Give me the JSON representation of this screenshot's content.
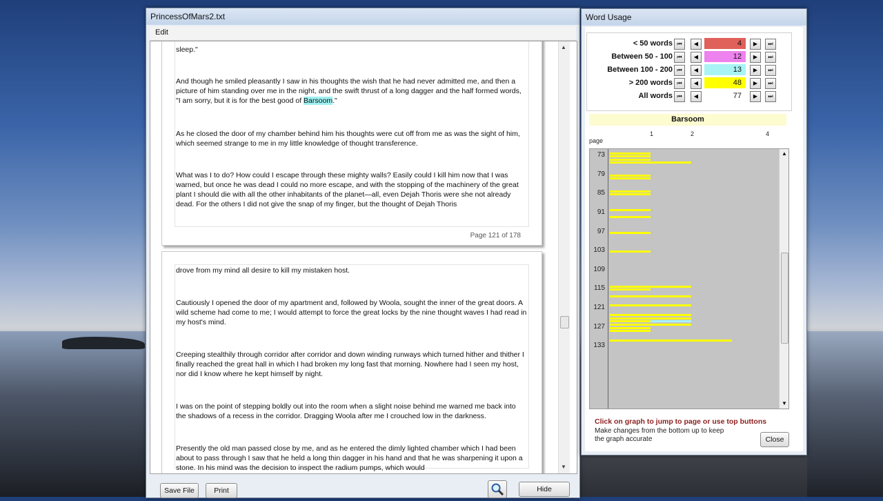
{
  "main_window": {
    "title": "PrincessOfMars2.txt",
    "menu": [
      "Edit"
    ],
    "page1": {
      "paragraphs": [
        "sleep.\"",
        "And though he smiled pleasantly I saw in his thoughts the wish that he had never admitted me, and then a picture of him standing over me in the night, and the swift thrust of a long dagger and the half formed words, \"I am sorry, but it is for the best good of ",
        "As he closed the door of my chamber behind him his thoughts were cut off from me as was the sight of him, which seemed strange to me in my little knowledge of thought transference.",
        "What was I to do? How could I escape through these mighty walls? Easily could I kill him now that I was warned, but once he was dead I could no more escape, and with the stopping of the machinery of the great plant I should die with all the other inhabitants of the planet—all, even Dejah Thoris were she not already dead. For the others I did not give the snap of my finger, but the thought of Dejah Thoris"
      ],
      "highlight_word": "Barsoom",
      "after_highlight": ".\"",
      "page_label": "Page 121 of 178"
    },
    "page2": {
      "paragraphs": [
        "drove from my mind all desire to kill my mistaken host.",
        "Cautiously I opened the door of my apartment and, followed by Woola, sought the inner of the great doors. A wild scheme had come to me; I would attempt to force the great locks by the nine thought waves I had read in my host's mind.",
        "Creeping stealthily through corridor after corridor and down winding runways which turned hither and thither I finally reached the great hall in which I had broken my long fast that morning. Nowhere had I seen my host, nor did I know where he kept himself by night.",
        "I was on the point of stepping boldly out into the room when a slight noise behind me warned me back into the shadows of a recess in the corridor. Dragging Woola after me I crouched low in the darkness.",
        "Presently the old man passed close by me, and as he entered the dimly lighted chamber which I had been about to pass through I saw that he held a long thin dagger in his hand and that he was sharpening it upon a stone. In his mind was the decision to inspect the radium pumps, which would"
      ]
    },
    "buttons": {
      "save": "Save File",
      "print": "Print",
      "hide": "Hide",
      "search_icon": "magnifier-icon"
    }
  },
  "word_usage": {
    "title": "Word Usage",
    "rows": [
      {
        "label": "< 50 words",
        "count": "4",
        "color": "#e0605a"
      },
      {
        "label": "Between 50 - 100",
        "count": "12",
        "color": "#ee82ee"
      },
      {
        "label": "Between 100 - 200",
        "count": "13",
        "color": "#a8f4f4"
      },
      {
        "label": "> 200 words",
        "count": "48",
        "color": "#ffff00"
      },
      {
        "label": "All words",
        "count": "77",
        "color": "#ffffff"
      }
    ],
    "selected_word": "Barsoom",
    "graph_header": {
      "page_label": "page",
      "cols": [
        "1",
        "2",
        "4"
      ]
    },
    "y_labels": [
      "73",
      "79",
      "85",
      "91",
      "97",
      "103",
      "109",
      "115",
      "121",
      "127",
      "133"
    ],
    "hint": "Click on graph to jump to page or use top buttons",
    "note": "Make changes from the bottom up to keep the graph accurate",
    "close": "Close"
  },
  "chart_data": {
    "type": "bar",
    "ylabel": "page",
    "x_ticks": [
      "1",
      "2",
      "4"
    ],
    "y_ticks": [
      73,
      79,
      85,
      91,
      97,
      103,
      109,
      115,
      121,
      127,
      133
    ],
    "series": [
      {
        "name": "< 50 words",
        "color": "#e0605a",
        "values": []
      },
      {
        "name": "Between 50 - 100",
        "color": "#ee82ee",
        "values": [
          {
            "page": 75,
            "count": 1
          },
          {
            "page": 126,
            "count": 1
          },
          {
            "page": 131,
            "count": 1
          }
        ]
      },
      {
        "name": "Between 100 - 200",
        "color": "#a8f4f4",
        "values": [
          {
            "page": 114,
            "count": 1
          },
          {
            "page": 120,
            "count": 1
          },
          {
            "page": 125,
            "count": 2
          },
          {
            "page": 131,
            "count": 2
          }
        ]
      },
      {
        "name": "> 200 words",
        "color": "#ffff00",
        "values": [
          {
            "page": 72,
            "count": 1
          },
          {
            "page": 73,
            "count": 1
          },
          {
            "page": 74,
            "count": 1
          },
          {
            "page": 75,
            "count": 2
          },
          {
            "page": 79,
            "count": 1
          },
          {
            "page": 80,
            "count": 1
          },
          {
            "page": 84,
            "count": 1
          },
          {
            "page": 85,
            "count": 1
          },
          {
            "page": 90,
            "count": 1
          },
          {
            "page": 92,
            "count": 1
          },
          {
            "page": 97,
            "count": 1
          },
          {
            "page": 103,
            "count": 1
          },
          {
            "page": 114,
            "count": 2
          },
          {
            "page": 115,
            "count": 1
          },
          {
            "page": 117,
            "count": 2
          },
          {
            "page": 120,
            "count": 2
          },
          {
            "page": 123,
            "count": 2
          },
          {
            "page": 124,
            "count": 2
          },
          {
            "page": 125,
            "count": 1
          },
          {
            "page": 126,
            "count": 2
          },
          {
            "page": 127,
            "count": 1
          },
          {
            "page": 128,
            "count": 1
          },
          {
            "page": 131,
            "count": 3
          }
        ]
      }
    ]
  }
}
